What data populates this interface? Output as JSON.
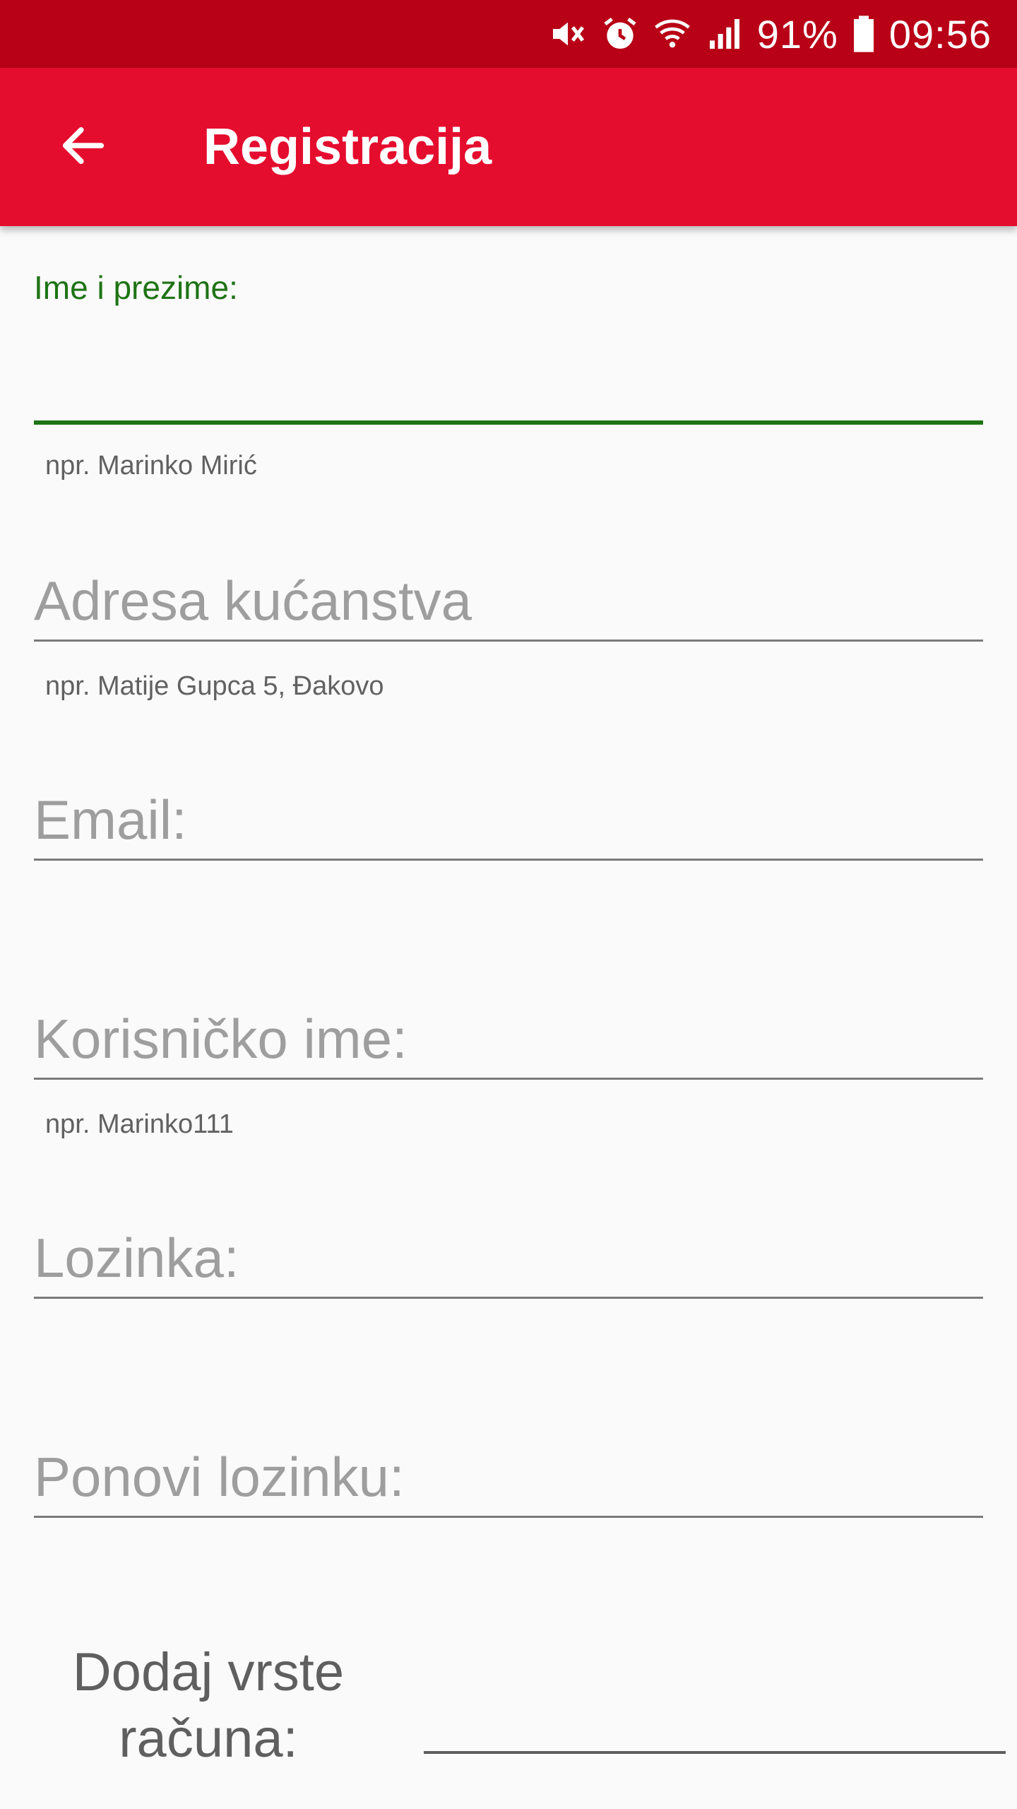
{
  "status_bar": {
    "battery": "91%",
    "time": "09:56",
    "icons": [
      "mute-icon",
      "alarm-icon",
      "wifi-icon",
      "signal-icon",
      "battery-icon"
    ]
  },
  "app_bar": {
    "title": "Registracija",
    "back_icon": "arrow-left-icon"
  },
  "form": {
    "full_name": {
      "label": "Ime i prezime:",
      "value": "",
      "helper": "npr. Marinko Mirić"
    },
    "address": {
      "placeholder": "Adresa kućanstva",
      "helper": "npr. Matije Gupca 5, Đakovo"
    },
    "email": {
      "placeholder": "Email:"
    },
    "username": {
      "placeholder": "Korisničko ime:",
      "helper": "npr. Marinko111"
    },
    "password": {
      "placeholder": "Lozinka:"
    },
    "repeat_password": {
      "placeholder": "Ponovi lozinku:"
    },
    "account_types": {
      "label_line1": "Dodaj vrste",
      "label_line2": "računa:"
    }
  },
  "colors": {
    "status_bar": "#b80016",
    "app_bar": "#e50d2e",
    "focus_green": "#1e7315",
    "background": "#fafafa"
  }
}
